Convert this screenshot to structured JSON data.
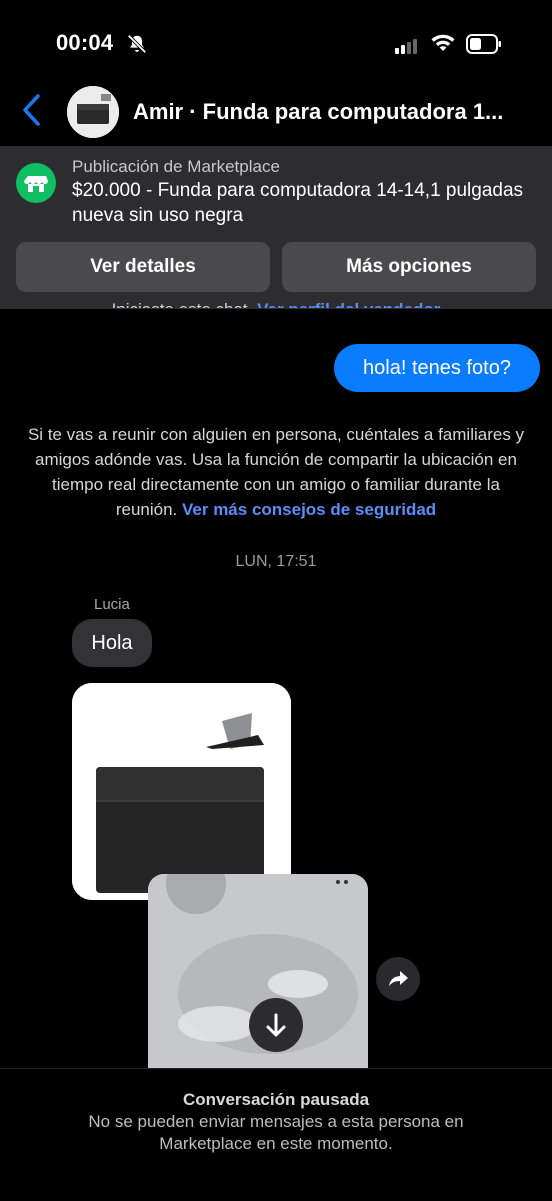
{
  "status_bar": {
    "time": "00:04",
    "battery_level": 0.45
  },
  "header": {
    "title": "Amir · Funda para computadora 1..."
  },
  "marketplace": {
    "subtitle": "Publicación de Marketplace",
    "title": "$20.000 - Funda para computadora 14-14,1 pulgadas nueva sin uso negra",
    "details_button": "Ver detalles",
    "options_button": "Más opciones",
    "icon": "store-icon"
  },
  "chat": {
    "cut_notice": "Iniciaste este chat.",
    "cut_link": "Ver perfil del vendedor",
    "outgoing_message": "hola! tenes foto?",
    "safety_text": "Si te vas a reunir con alguien en persona, cuéntales a familiares y amigos adónde vas. Usa la función de compartir la ubicación en tiempo real directamente con un amigo o familiar durante la reunión.",
    "safety_link": "Ver más consejos de seguridad",
    "timestamp": "LUN, 17:51",
    "sender_name": "Lucia",
    "incoming_message": "Hola"
  },
  "footer": {
    "title": "Conversación pausada",
    "description": "No se pueden enviar mensajes a esta persona en Marketplace en este momento."
  },
  "colors": {
    "accent": "#0a7cff",
    "link": "#5b8cf7",
    "marketplace_green": "#0fbf62"
  }
}
